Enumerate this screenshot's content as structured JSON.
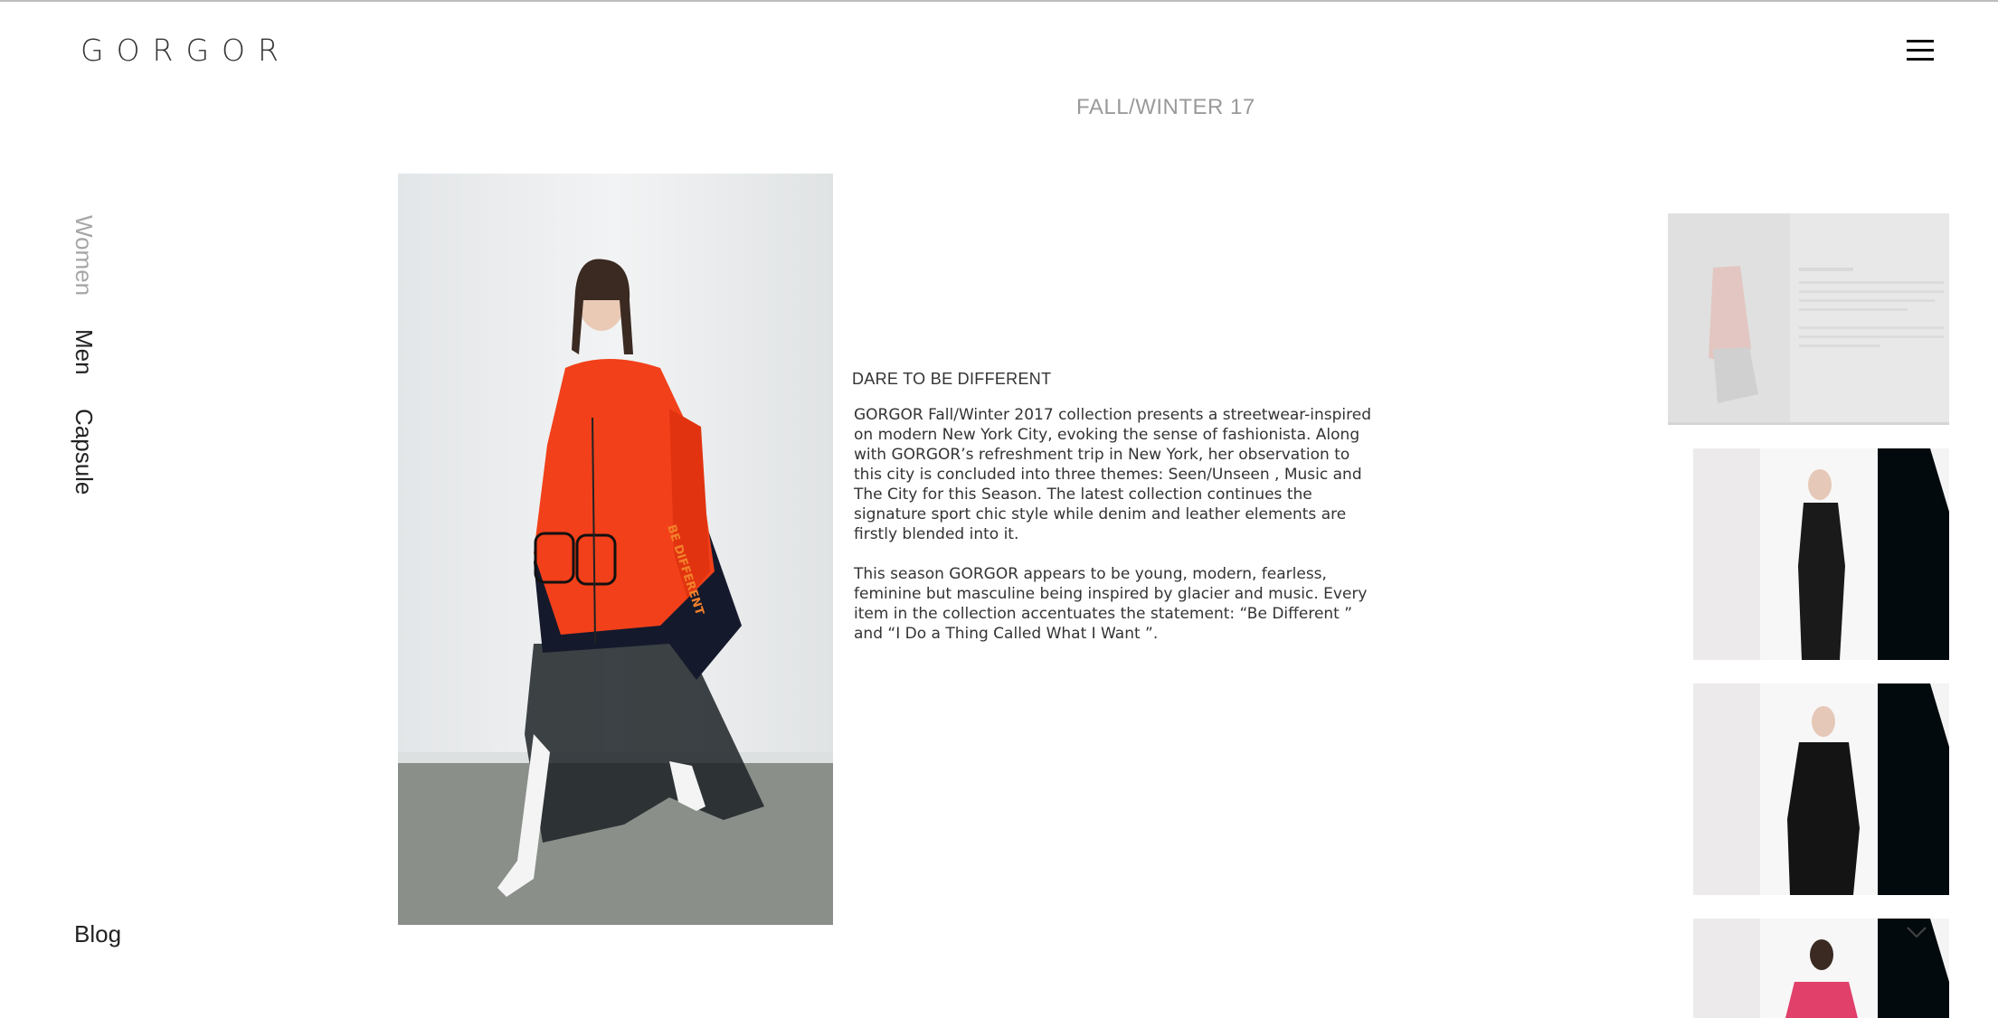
{
  "brand": {
    "logo": "GORGOR"
  },
  "header": {
    "season_title": "FALL/WINTER 17"
  },
  "nav": {
    "items": [
      {
        "label": "Women",
        "active": true
      },
      {
        "label": "Men",
        "active": false
      },
      {
        "label": "Capsule",
        "active": false
      }
    ],
    "blog_label": "Blog"
  },
  "icons": {
    "menu": "hamburger-menu-icon"
  },
  "article": {
    "headline": "DARE TO BE DIFFERENT",
    "paragraphs": [
      "GORGOR Fall/Winter 2017 collection presents a streetwear-inspired on modern New York City, evoking the sense of fashionista. Along with GORGOR’s refreshment trip in New York, her observation to this city is concluded into three themes: Seen/Unseen , Music and The City for this Season. The latest collection continues the signature sport chic style while denim and leather elements are firstly blended into it.",
      "This season GORGOR appears to be young, modern, fearless, feminine but masculine being inspired by glacier and music. Every item in the collection accentuates the statement: “Be Different ” and “I Do a Thing Called What I Want ”."
    ],
    "photo_text": "BE DIFFERENT"
  },
  "colors": {
    "accent_orange": "#f2401a",
    "nav_inactive": "#a6a6a6",
    "season_gray": "#9a9a9a"
  }
}
